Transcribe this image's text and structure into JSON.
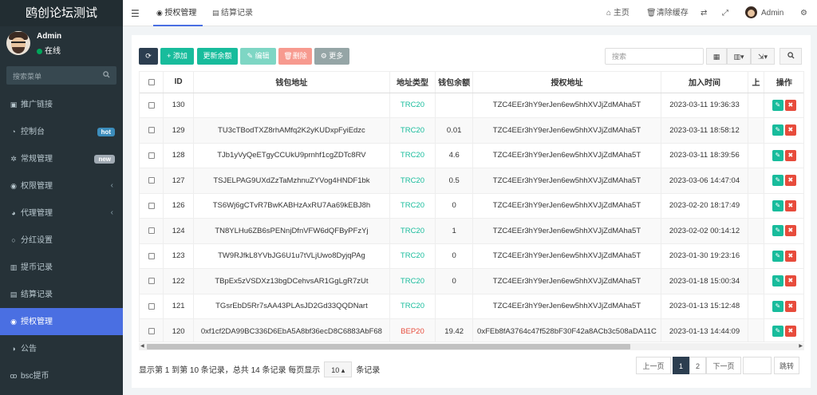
{
  "brand": "鸥创论坛测试",
  "user": {
    "name": "Admin",
    "status": "在线"
  },
  "sidebar": {
    "search_placeholder": "搜索菜单",
    "items": [
      {
        "label": "推广链接"
      },
      {
        "label": "控制台",
        "badge": "hot"
      },
      {
        "label": "常规管理",
        "badge": "new"
      },
      {
        "label": "权限管理"
      },
      {
        "label": "代理管理"
      },
      {
        "label": "分红设置"
      },
      {
        "label": "提币记录"
      },
      {
        "label": "结算记录"
      },
      {
        "label": "授权管理"
      },
      {
        "label": "公告"
      },
      {
        "label": "bsc提币"
      }
    ]
  },
  "topbar": {
    "tabs": [
      {
        "label": "授权管理"
      },
      {
        "label": "结算记录"
      }
    ],
    "home": "主页",
    "clear_cache": "清除缓存",
    "admin": "Admin"
  },
  "toolbar": {
    "add": "添加",
    "recalc": "更新余额",
    "edit": "编辑",
    "delete": "删除",
    "more": "更多",
    "search_placeholder": "搜索"
  },
  "table": {
    "headers": [
      "ID",
      "钱包地址",
      "地址类型",
      "钱包余额",
      "授权地址",
      "加入时间",
      "上",
      "操作"
    ],
    "rows": [
      {
        "id": "130",
        "wallet": "",
        "type": "TRC20",
        "balance": "",
        "auth": "TZC4EEr3hY9erJen6ew5hhXVJjZdMAha5T",
        "time": "2023-03-11 19:36:33"
      },
      {
        "id": "129",
        "wallet": "TU3cTBodTXZ8rhAMfq2K2yKUDxpFyiEdzc",
        "type": "TRC20",
        "balance": "0.01",
        "auth": "TZC4EEr3hY9erJen6ew5hhXVJjZdMAha5T",
        "time": "2023-03-11 18:58:12"
      },
      {
        "id": "128",
        "wallet": "TJb1yVyQeETgyCCUkU9prnhf1cgZDTc8RV",
        "type": "TRC20",
        "balance": "4.6",
        "auth": "TZC4EEr3hY9erJen6ew5hhXVJjZdMAha5T",
        "time": "2023-03-11 18:39:56"
      },
      {
        "id": "127",
        "wallet": "TSJELPAG9UXdZzTaMzhnuZYVog4HNDF1bk",
        "type": "TRC20",
        "balance": "0.5",
        "auth": "TZC4EEr3hY9erJen6ew5hhXVJjZdMAha5T",
        "time": "2023-03-06 14:47:04"
      },
      {
        "id": "126",
        "wallet": "TS6Wj6gCTvR7BwKABHzAxRU7Aa69kEBJ8h",
        "type": "TRC20",
        "balance": "0",
        "auth": "TZC4EEr3hY9erJen6ew5hhXVJjZdMAha5T",
        "time": "2023-02-20 18:17:49"
      },
      {
        "id": "124",
        "wallet": "TN8YLHu6ZB6sPENnjDfnVFW6dQFByPFzYj",
        "type": "TRC20",
        "balance": "1",
        "auth": "TZC4EEr3hY9erJen6ew5hhXVJjZdMAha5T",
        "time": "2023-02-02 00:14:12"
      },
      {
        "id": "123",
        "wallet": "TW9RJfkL8YVbJG6U1u7tVLjUwo8DyjqPAg",
        "type": "TRC20",
        "balance": "0",
        "auth": "TZC4EEr3hY9erJen6ew5hhXVJjZdMAha5T",
        "time": "2023-01-30 19:23:16"
      },
      {
        "id": "122",
        "wallet": "TBpEx5zVSDXz13bgDCehvsAR1GgLgR7zUt",
        "type": "TRC20",
        "balance": "0",
        "auth": "TZC4EEr3hY9erJen6ew5hhXVJjZdMAha5T",
        "time": "2023-01-18 15:00:34"
      },
      {
        "id": "121",
        "wallet": "TGsrEbD5Rr7sAA43PLAsJD2Gd33QQDNart",
        "type": "TRC20",
        "balance": "",
        "auth": "TZC4EEr3hY9erJen6ew5hhXVJjZdMAha5T",
        "time": "2023-01-13 15:12:48"
      },
      {
        "id": "120",
        "wallet": "0xf1cf2DA99BC336D6EbA5A8bf36ecD8C6883AbF68",
        "type": "BEP20",
        "balance": "19.42",
        "auth": "0xFEb8fA3764c47f528bF30F42a8ACb3c508aDA11C",
        "time": "2023-01-13 14:44:09"
      }
    ]
  },
  "footer": {
    "info_prefix": "显示第 1 到第 10 条记录，总共 14 条记录 每页显示",
    "page_size": "10",
    "info_suffix": "条记录",
    "prev": "上一页",
    "pages": [
      "1",
      "2"
    ],
    "next": "下一页",
    "jump": "跳转"
  }
}
